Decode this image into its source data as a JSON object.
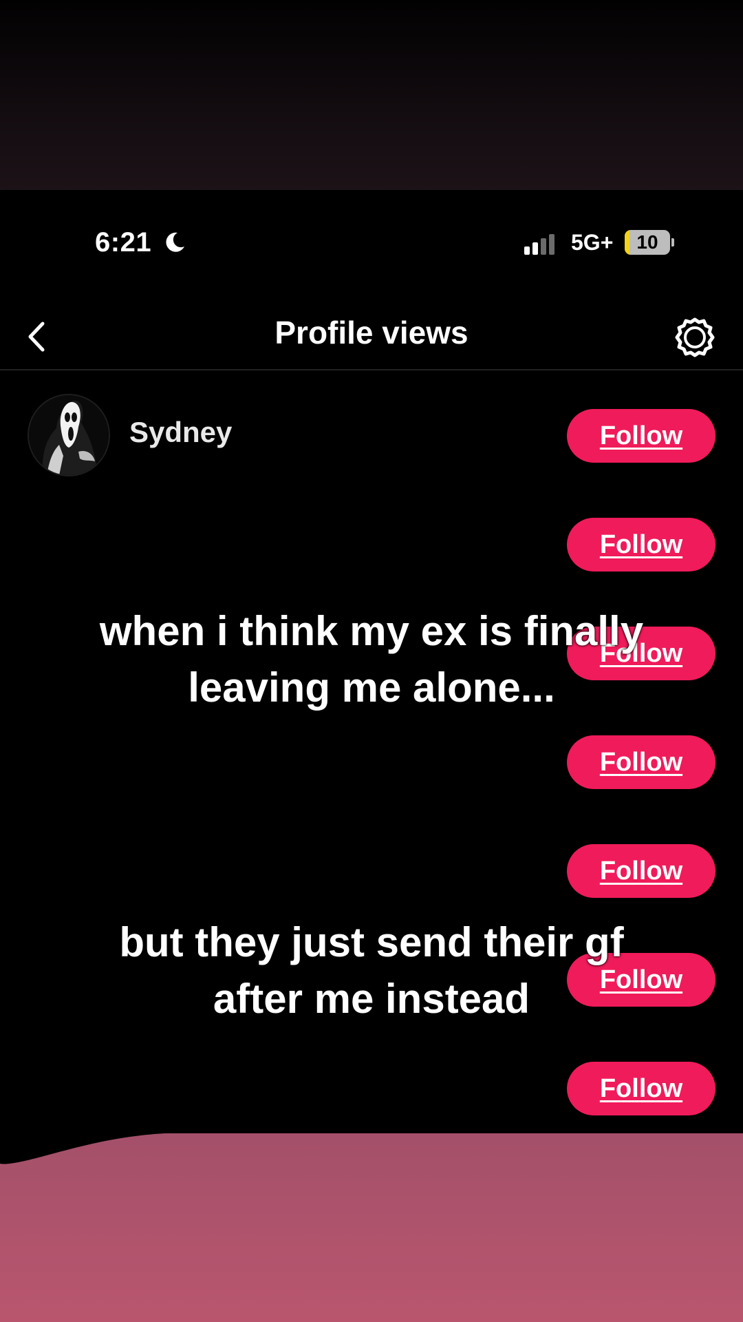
{
  "status_bar": {
    "time": "6:21",
    "network": "5G+",
    "battery_level": "10",
    "battery_fraction": 0.1
  },
  "nav": {
    "title": "Profile views",
    "back_icon": "chevron-left-icon",
    "settings_icon": "gear-icon"
  },
  "profiles": [
    {
      "name": "Sydney",
      "follow_label": "Follow"
    },
    {
      "name": "",
      "follow_label": "Follow"
    },
    {
      "name": "",
      "follow_label": "Follow"
    },
    {
      "name": "",
      "follow_label": "Follow"
    },
    {
      "name": "",
      "follow_label": "Follow"
    },
    {
      "name": "",
      "follow_label": "Follow"
    },
    {
      "name": "",
      "follow_label": "Follow"
    }
  ],
  "captions": {
    "first": [
      "when i think my ex is finally",
      "leaving me alone..."
    ],
    "second": [
      "but they just send their gf",
      "after me instead"
    ]
  },
  "colors": {
    "follow_button": "#f01b5a",
    "background": "#000000",
    "bottom_pink": "#b9566e"
  }
}
